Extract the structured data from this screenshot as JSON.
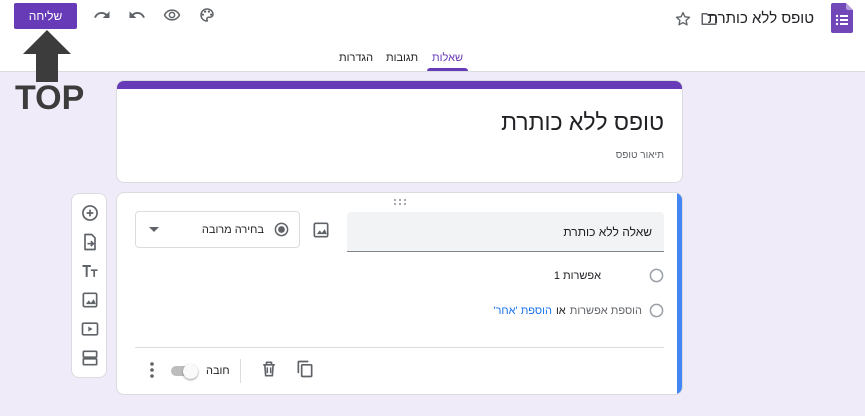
{
  "header": {
    "app_title": "טופס ללא כותרת",
    "send_label": "שליחה",
    "icons": [
      "forms-logo-icon",
      "folder-icon",
      "star-icon",
      "palette-icon",
      "preview-eye-icon",
      "undo-icon",
      "redo-icon"
    ]
  },
  "tabs": [
    {
      "label": "שאלות",
      "active": true
    },
    {
      "label": "תגובות",
      "active": false
    },
    {
      "label": "הגדרות",
      "active": false
    }
  ],
  "annotation": {
    "label": "TOP"
  },
  "form": {
    "title": "טופס ללא כותרת",
    "description_placeholder": "תיאור טופס"
  },
  "question": {
    "text": "שאלה ללא כותרת",
    "type_label": "בחירה מרובה",
    "options": [
      {
        "label": "אפשרות 1"
      }
    ],
    "add_option_label": "הוספת אפשרות",
    "or_label": "או",
    "add_other_label": "הוספת 'אחר'",
    "required_label": "חובה",
    "required_on": false
  },
  "toolbar": {
    "items": [
      "add-question-icon",
      "import-questions-icon",
      "add-title-icon",
      "add-image-icon",
      "add-video-icon",
      "add-section-icon"
    ]
  },
  "colors": {
    "accent": "#673ab7",
    "background": "#f0ebf8",
    "focus": "#4285f4",
    "link": "#1a73e8"
  }
}
